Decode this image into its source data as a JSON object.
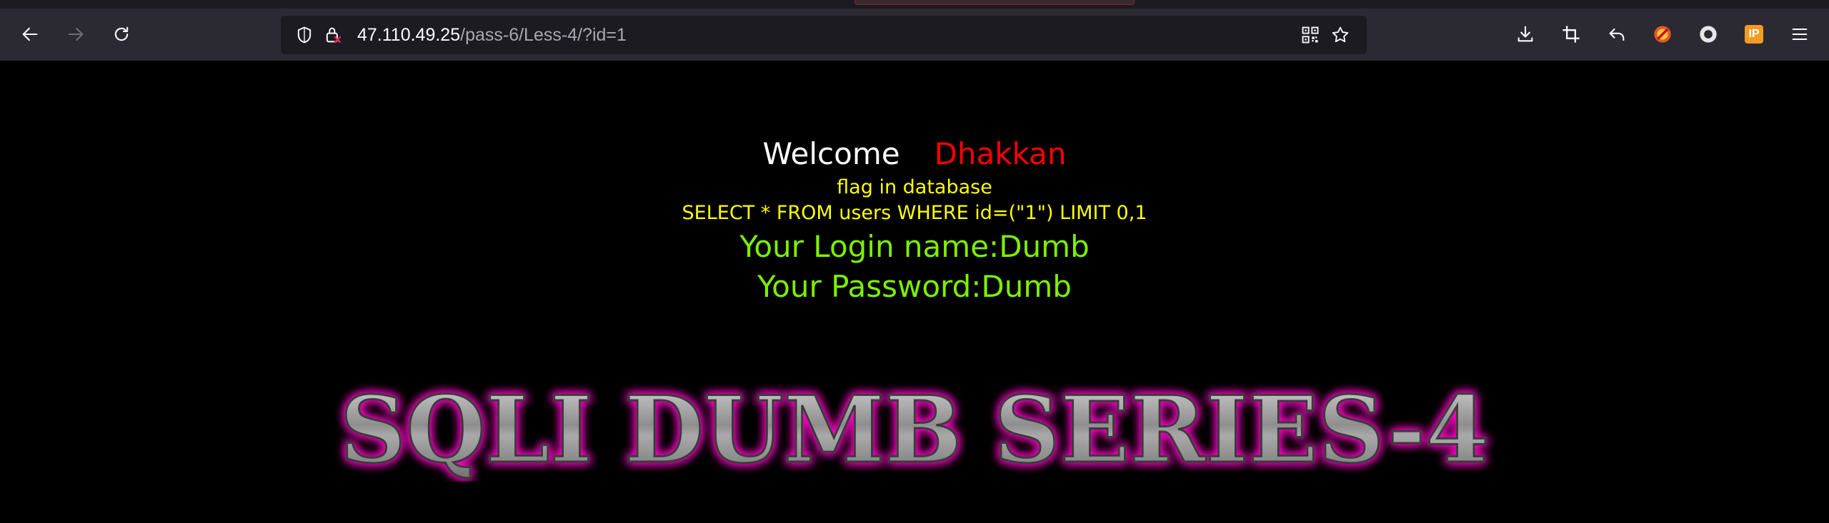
{
  "browser": {
    "url_host": "47.110.49.25",
    "url_path": "/pass-6/Less-4/?id=1",
    "extension_badge": "IP",
    "icons": {
      "back": "arrow-left-icon",
      "forward": "arrow-right-icon",
      "reload": "reload-icon",
      "shield": "shield-icon",
      "lock": "lock-insecure-icon",
      "qr": "qr-code-icon",
      "bookmark": "star-icon",
      "downloads": "download-icon",
      "screenshot": "crop-icon",
      "undo": "undo-icon",
      "extension1": "red-extension-icon",
      "extension2": "circle-extension-icon",
      "extension3": "ip-extension-icon",
      "menu": "hamburger-menu-icon"
    }
  },
  "page": {
    "welcome": "Welcome",
    "name": "Dhakkan",
    "flag_hint": "flag in database",
    "query": "SELECT * FROM users WHERE id=(\"1\") LIMIT 0,1",
    "login_name": "Your Login name:Dumb",
    "password": "Your Password:Dumb",
    "banner_title": "SQLI DUMB SERIES-4"
  },
  "colors": {
    "background": "#000000",
    "welcome": "#ffffff",
    "name": "#ff0000",
    "info": "#ffff00",
    "credentials": "#7cf000",
    "banner_glow": "#ff00c8",
    "banner_fill": "#9a9a9a"
  }
}
